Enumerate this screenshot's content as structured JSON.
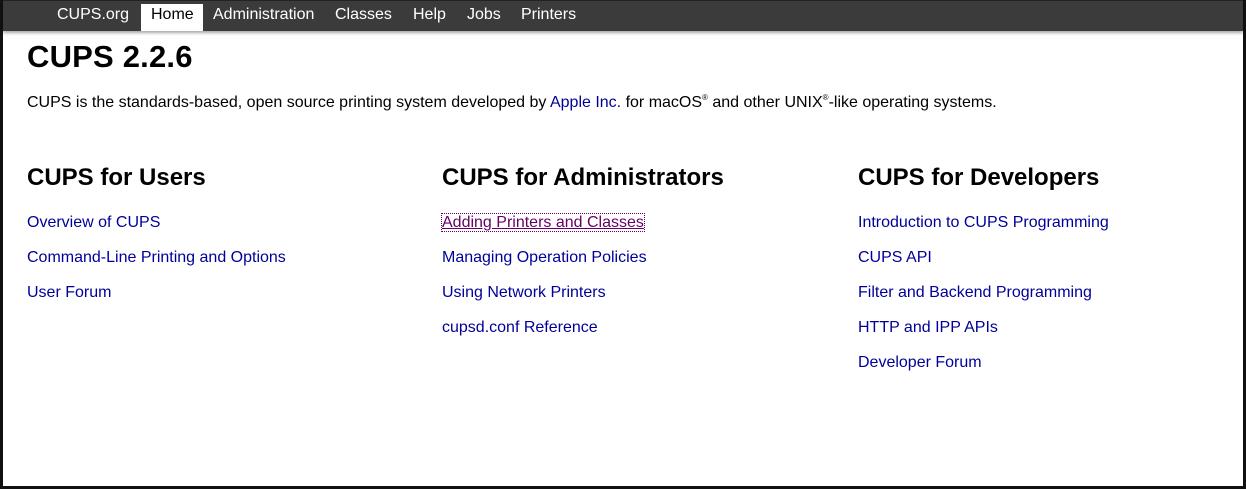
{
  "nav": {
    "items": [
      {
        "label": "CUPS.org"
      },
      {
        "label": "Home",
        "active": true
      },
      {
        "label": "Administration"
      },
      {
        "label": "Classes"
      },
      {
        "label": "Help"
      },
      {
        "label": "Jobs"
      },
      {
        "label": "Printers"
      }
    ]
  },
  "main": {
    "title": "CUPS 2.2.6",
    "intro": {
      "prefix": "CUPS is the standards-based, open source printing system developed by ",
      "link": "Apple Inc.",
      "middle": " for macOS",
      "reg1": "®",
      "middle2": " and other UNIX",
      "reg2": "®",
      "suffix": "-like operating systems."
    }
  },
  "columns": [
    {
      "heading": "CUPS for Users",
      "links": [
        "Overview of CUPS",
        "Command-Line Printing and Options",
        "User Forum"
      ]
    },
    {
      "heading": "CUPS for Administrators",
      "links": [
        "Adding Printers and Classes",
        "Managing Operation Policies",
        "Using Network Printers",
        "cupsd.conf Reference"
      ]
    },
    {
      "heading": "CUPS for Developers",
      "links": [
        "Introduction to CUPS Programming",
        "CUPS API",
        "Filter and Backend Programming",
        "HTTP and IPP APIs",
        "Developer Forum"
      ]
    }
  ],
  "colors": {
    "navbar": "#3b3b3b",
    "link": "#000099",
    "visited_link": "#660066"
  }
}
